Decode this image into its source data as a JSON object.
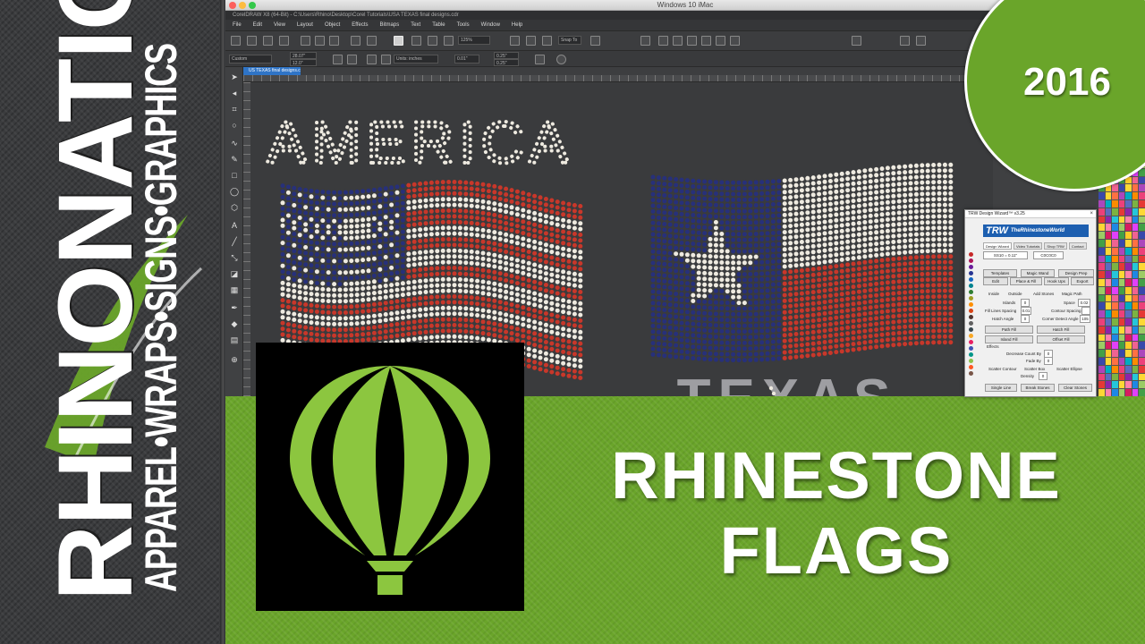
{
  "brand": {
    "name": "RHINONATION",
    "tagline": "APPAREL•WRAPS•SIGNS•GRAPHICS",
    "accent_color": "#6aa52a"
  },
  "badge": {
    "year": "2016"
  },
  "headline": {
    "line1": "RHINESTONE",
    "line2": "FLAGS"
  },
  "window": {
    "title": "Windows 10 iMac",
    "path": "CorelDRAW X8 (64-Bit) - C:\\Users\\Rhino\\Desktop\\Corel Tutorials\\USA TEXAS final designs.cdr",
    "menu": [
      "File",
      "Edit",
      "View",
      "Layout",
      "Object",
      "Effects",
      "Bitmaps",
      "Text",
      "Table",
      "Tools",
      "Window",
      "Help"
    ],
    "toolbar": {
      "zoom": "125%",
      "snap": "Snap To",
      "page_size": "Custom",
      "width": "28.07\"",
      "height": "12.0\"",
      "units": "Units: inches",
      "nudge": "0.01\"",
      "dup_x": "0.25\"",
      "dup_y": "0.25\""
    },
    "doc_tab": "US TEXAS final designs.cdr"
  },
  "canvas": {
    "title_text": "AMERICA",
    "second_title": "TEXAS",
    "colors": {
      "navy": "#27307a",
      "red": "#c8372a",
      "white": "#eeeae0",
      "grey": "#a9a9ad"
    }
  },
  "trw": {
    "window_title": "TRW Design Wizard™ v3.25",
    "close": "×",
    "logo_mark": "TRW",
    "logo_sub": "TheRhinestoneWorld",
    "tabs": [
      "Design Wizard",
      "Video Tutorials",
      "Shop TRW",
      "Contact"
    ],
    "stone_size": "SS10 = 0.11\"",
    "stone_color": "C0C0C0",
    "buttons_row1": [
      "Templates",
      "Magic Wand",
      "Design Prep"
    ],
    "buttons_row2": [
      "Edit",
      "Place & Fill",
      "Hook Ups",
      "Export"
    ],
    "options": {
      "inside": "Inside",
      "outside": "Outside",
      "add_stones": "Add Stones",
      "magic_path": "Magic Path",
      "islands": "Islands",
      "islands_val": "0",
      "space": "Space",
      "space_val": "0.02",
      "fill_lines": "Fill Lines Spacing",
      "fill_lines_val": "0.01",
      "contour": "Contour Spacing",
      "contour_val": "",
      "hatch_angle": "Hatch Angle",
      "hatch_angle_val": "0",
      "corner": "Corner Detect Angle",
      "corner_val": "105"
    },
    "fill_buttons": [
      "Path Fill",
      "Hatch Fill",
      "Island Fill",
      "Offset Fill"
    ],
    "effects": {
      "label": "Effects",
      "decrease": "Decrease Count By",
      "decrease_val": "0",
      "fade": "Fade By",
      "fade_val": "0",
      "scatter_contour": "Scatter Contour",
      "scatter_box": "Scatter Box",
      "scatter_ellipse": "Scatter Ellipse",
      "density": "Density",
      "density_val": "0"
    },
    "bottom_buttons": [
      "Single Line",
      "Break Stones",
      "Clear Stones"
    ]
  }
}
